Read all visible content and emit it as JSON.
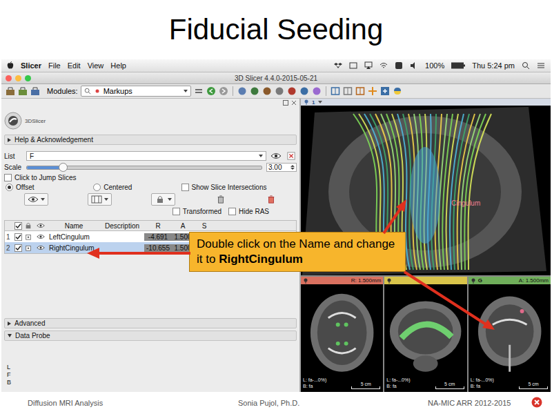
{
  "slide": {
    "title": "Fiducial Seeding",
    "footer": {
      "left": "Diffusion MRI Analysis",
      "center": "Sonia Pujol, Ph.D.",
      "right": "NA-MIC ARR 2012-2015"
    }
  },
  "menubar": {
    "app": "Slicer",
    "items": [
      "File",
      "Edit",
      "View",
      "Help"
    ],
    "battery": "100%",
    "clock": "Thu 5:24 pm"
  },
  "window": {
    "title": "3D Slicer 4.4.0-2015-05-21"
  },
  "toolbar": {
    "modules_label": "Modules:",
    "module": "Markups"
  },
  "panel": {
    "logo": "3DSlicer",
    "help": {
      "label": "Help & Acknowledgement",
      "expanded": false
    },
    "list": {
      "label": "List",
      "value": "F"
    },
    "scale": {
      "label": "Scale",
      "value": "3.00",
      "level": 0.15
    },
    "jump": {
      "label": "Click to Jump Slices",
      "checked": false
    },
    "modes": [
      {
        "label": "Offset",
        "selected": true
      },
      {
        "label": "Centered",
        "selected": false
      }
    ],
    "intersections": {
      "label": "Show Slice Intersections",
      "checked": false
    },
    "transformed": {
      "label": "Transformed",
      "checked": false
    },
    "hide_ras": {
      "label": "Hide RAS",
      "checked": false
    },
    "table": {
      "columns": [
        "Name",
        "Description",
        "R",
        "A",
        "S"
      ],
      "all_checked": true,
      "rows": [
        {
          "index": "1",
          "checked": true,
          "visible": true,
          "name": "LeftCingulum",
          "description": "",
          "r": "-4.691",
          "a": "1.500",
          "selected": false
        },
        {
          "index": "2",
          "checked": true,
          "visible": true,
          "name": "RightCingulum",
          "description": "",
          "r": "-10.655",
          "a": "1.500",
          "selected": true
        }
      ]
    },
    "sections": [
      {
        "label": "Advanced",
        "expanded": false
      },
      {
        "label": "Data Probe",
        "expanded": true
      }
    ],
    "probe": [
      "L",
      "F",
      "B"
    ]
  },
  "view3d": {
    "label": "1",
    "annotation": "Cingulum"
  },
  "slices": [
    {
      "kind": "axial",
      "color": "#d9705f",
      "reading": "R: 1.500mm",
      "bottom": [
        "L: fa-...0%)",
        "B: fa"
      ],
      "scale": "5 cm"
    },
    {
      "kind": "sagittal",
      "color": "#d9c44a",
      "bottom": [
        "L: fa-...0%)",
        "B: fa"
      ],
      "scale": "5 cm"
    },
    {
      "kind": "coronal",
      "color": "#6fae5a",
      "letter": "G",
      "reading": "A: 1.500mm",
      "bottom": [
        "L: fa-...0%)",
        "B: fa"
      ],
      "scale": "5 cm"
    }
  ],
  "callout": {
    "text": "Double click on the Name and change it to",
    "bold": "RightCingulum"
  }
}
